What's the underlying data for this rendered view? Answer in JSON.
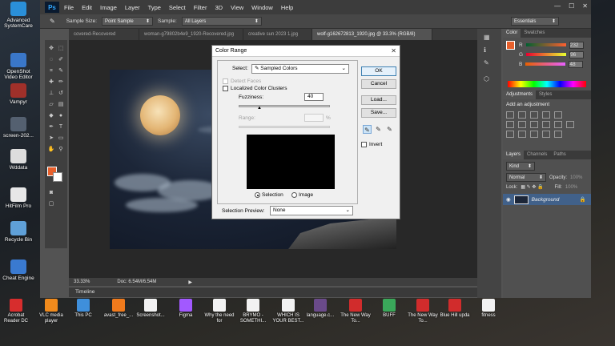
{
  "desktop_icons_left": [
    {
      "label": "Advanced SystemCare",
      "color": "#2a8fd8"
    },
    {
      "label": "OpenShot Video Editor",
      "color": "#3a77c9"
    },
    {
      "label": "Vampyr",
      "color": "#a0302a"
    },
    {
      "label": "screen-202...",
      "color": "#546070"
    },
    {
      "label": "Wddata",
      "color": "#dddddd"
    },
    {
      "label": "HitFilm Pro",
      "color": "#e7e7e7"
    },
    {
      "label": "Recycle Bin",
      "color": "#5fa0d8"
    },
    {
      "label": "Cheat Engine",
      "color": "#3a7ad0"
    }
  ],
  "desktop_icons_bottom": [
    {
      "label": "Acrobat Reader DC",
      "color": "#d72d2d"
    },
    {
      "label": "VLC media player",
      "color": "#f08a1c"
    },
    {
      "label": "This PC",
      "color": "#3f8fdb"
    },
    {
      "label": "avast_free_...",
      "color": "#f07a1c"
    },
    {
      "label": "Screenshot...",
      "color": "#f2f2f2"
    },
    {
      "label": "Figma",
      "color": "#a259ff"
    },
    {
      "label": "Why the need for",
      "color": "#f2f2f2"
    },
    {
      "label": "BRYMO - SOMETHI...",
      "color": "#f2f2f2"
    },
    {
      "label": "WHICH IS YOUR BEST...",
      "color": "#f2f2f2"
    },
    {
      "label": "language.c...",
      "color": "#6a4a8a"
    },
    {
      "label": "The New Way To...",
      "color": "#d12c2c"
    },
    {
      "label": "BUFF",
      "color": "#3aa85a"
    },
    {
      "label": "The New Way To...",
      "color": "#d12c2c"
    },
    {
      "label": "Blue Hill upda",
      "color": "#d12c2c"
    },
    {
      "label": "fitness",
      "color": "#f2f2f2"
    }
  ],
  "menubar": {
    "logo": "Ps",
    "items": [
      "File",
      "Edit",
      "Image",
      "Layer",
      "Type",
      "Select",
      "Filter",
      "3D",
      "View",
      "Window",
      "Help"
    ],
    "controls": [
      "—",
      "☐",
      "✕"
    ]
  },
  "options": {
    "sample_size_label": "Sample Size:",
    "sample_size_value": "Point Sample",
    "sample_label": "Sample:",
    "sample_value": "All Layers",
    "workspace": "Essentials"
  },
  "doc_tabs": [
    {
      "label": "covered-Recovered",
      "active": false
    },
    {
      "label": "woman-g79802b4e9_1920-Recovered.jpg",
      "active": false
    },
    {
      "label": "creative sun 2023 1.jpg",
      "active": false
    },
    {
      "label": "wolf-g162672813_1920.jpg @ 33.3% (RGB/8)",
      "active": true
    }
  ],
  "status": {
    "zoom": "33.33%",
    "doc": "Doc: 6.54M/6.54M"
  },
  "timeline": "Timeline",
  "color_panel": {
    "tabs": [
      "Color",
      "Swatches"
    ],
    "channels": [
      {
        "name": "R",
        "value": "232"
      },
      {
        "name": "G",
        "value": "96"
      },
      {
        "name": "B",
        "value": "48"
      }
    ],
    "foreground": "#e8602c"
  },
  "adjust_panel": {
    "tabs": [
      "Adjustments",
      "Styles"
    ],
    "title": "Add an adjustment"
  },
  "layers_panel": {
    "tabs": [
      "Layers",
      "Channels",
      "Paths"
    ],
    "kind": "Kind",
    "blend": "Normal",
    "opacity_label": "Opacity:",
    "opacity": "100%",
    "lock_label": "Lock:",
    "fill_label": "Fill:",
    "fill": "100%",
    "layer_name": "Background"
  },
  "dialog": {
    "title": "Color Range",
    "select_label": "Select:",
    "select_value": "Sampled Colors",
    "detect_faces": "Detect Faces",
    "localized": "Localized Color Clusters",
    "fuzziness_label": "Fuzziness:",
    "fuzziness": "40",
    "range_label": "Range:",
    "range_unit": "%",
    "radio_selection": "Selection",
    "radio_image": "Image",
    "preview_label": "Selection Preview:",
    "preview_value": "None",
    "buttons": [
      "OK",
      "Cancel",
      "Load...",
      "Save..."
    ],
    "invert": "Invert"
  }
}
